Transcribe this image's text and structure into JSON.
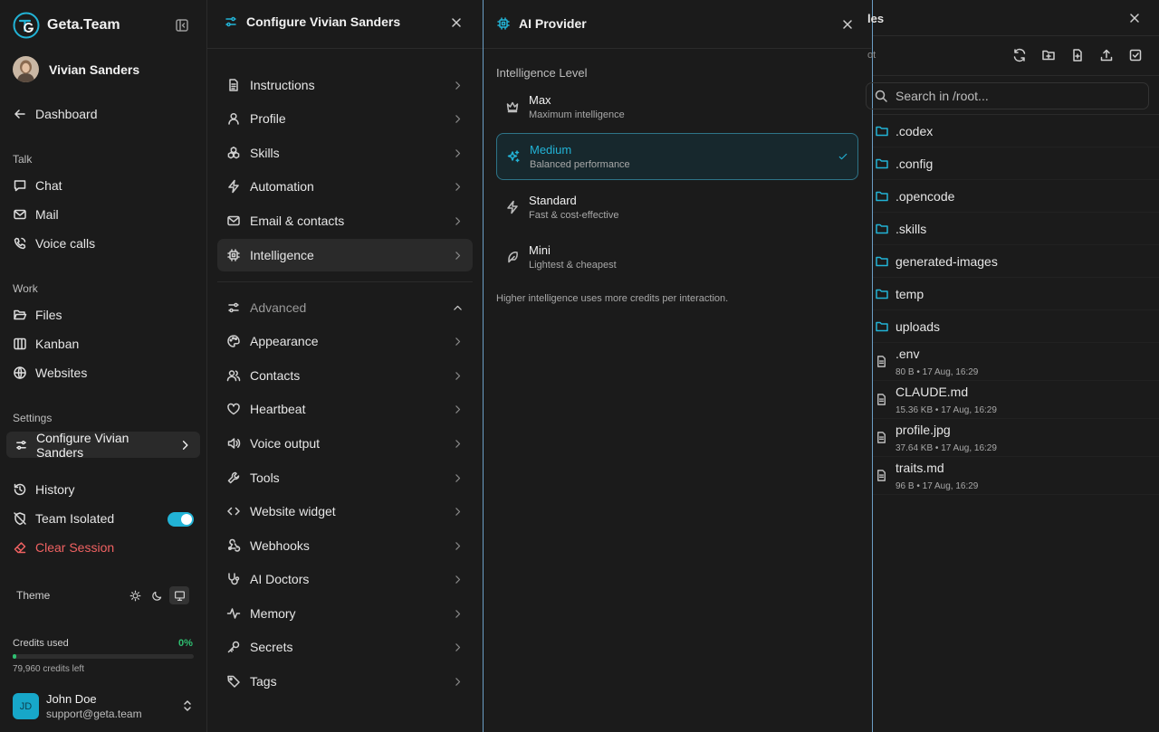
{
  "brand": {
    "name": "Geta.Team"
  },
  "sidebar": {
    "agent_name": "Vivian Sanders",
    "dashboard": "Dashboard",
    "talk_label": "Talk",
    "talk_items": [
      "Chat",
      "Mail",
      "Voice calls"
    ],
    "work_label": "Work",
    "work_items": [
      "Files",
      "Kanban",
      "Websites"
    ],
    "settings_label": "Settings",
    "configure": "Configure Vivian Sanders",
    "history": "History",
    "team_isolated": "Team Isolated",
    "team_isolated_on": true,
    "clear_session": "Clear Session",
    "theme_label": "Theme",
    "credits_label": "Credits used",
    "credits_pct": "0%",
    "credits_fraction": 0.02,
    "credits_left": "79,960 credits left",
    "account": {
      "initials": "JD",
      "name": "John Doe",
      "email": "support@geta.team"
    }
  },
  "configure_panel": {
    "title": "Configure Vivian Sanders",
    "items": [
      "Instructions",
      "Profile",
      "Skills",
      "Automation",
      "Email & contacts",
      "Intelligence"
    ],
    "advanced_label": "Advanced",
    "advanced_items": [
      "Appearance",
      "Contacts",
      "Heartbeat",
      "Voice output",
      "Tools",
      "Website widget",
      "Webhooks",
      "AI Doctors",
      "Memory",
      "Secrets",
      "Tags"
    ]
  },
  "provider_panel": {
    "title": "AI Provider",
    "level_label": "Intelligence Level",
    "levels": [
      {
        "title": "Max",
        "desc": "Maximum intelligence"
      },
      {
        "title": "Medium",
        "desc": "Balanced performance"
      },
      {
        "title": "Standard",
        "desc": "Fast & cost-effective"
      },
      {
        "title": "Mini",
        "desc": "Lightest & cheapest"
      }
    ],
    "selected": "Medium",
    "hint": "Higher intelligence uses more credits per interaction."
  },
  "files_panel": {
    "title": "les",
    "path": "ot",
    "search_placeholder": "Search in /root...",
    "folders": [
      ".codex",
      ".config",
      ".opencode",
      ".skills",
      "generated-images",
      "temp",
      "uploads"
    ],
    "files": [
      {
        "name": ".env",
        "meta": "80 B • 17 Aug, 16:29"
      },
      {
        "name": "CLAUDE.md",
        "meta": "15.36 KB • 17 Aug, 16:29"
      },
      {
        "name": "profile.jpg",
        "meta": "37.64 KB • 17 Aug, 16:29"
      },
      {
        "name": "traits.md",
        "meta": "96 B • 17 Aug, 16:29"
      }
    ]
  },
  "colors": {
    "accent": "#22b3d6",
    "success": "#2fbf71",
    "danger": "#f06262",
    "background": "#1b1b1b"
  }
}
